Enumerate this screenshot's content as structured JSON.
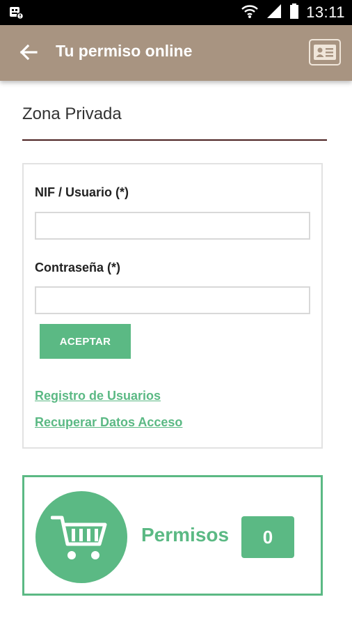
{
  "status_bar": {
    "time": "13:11",
    "icons": [
      "notification-icon",
      "wifi-icon",
      "signal-icon",
      "battery-icon"
    ]
  },
  "app_bar": {
    "title": "Tu permiso online",
    "back_icon": "arrow-back-icon",
    "action_icon": "id-card-icon",
    "background": "#a89481"
  },
  "section": {
    "title": "Zona Privada"
  },
  "login": {
    "user_label": "NIF / Usuario (*)",
    "user_value": "",
    "password_label": "Contraseña (*)",
    "password_value": "",
    "accept_label": "ACEPTAR",
    "register_link": "Registro de Usuarios",
    "recover_link": "Recuperar Datos Acceso"
  },
  "permits": {
    "label": "Permisos",
    "count": "0",
    "icon": "shopping-cart-icon"
  },
  "colors": {
    "accent": "#5bb984",
    "divider": "#4a2020"
  }
}
